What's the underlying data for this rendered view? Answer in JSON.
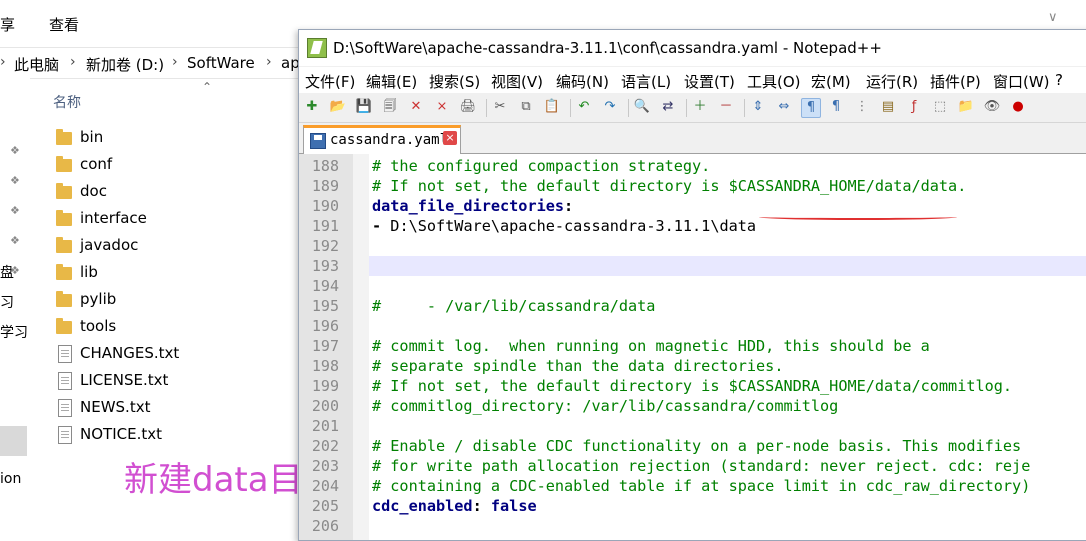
{
  "explorer": {
    "ribbon_tabs": [
      "享",
      "查看"
    ],
    "breadcrumb": [
      "此电脑",
      "新加卷 (D:)",
      "SoftWare",
      "ap"
    ],
    "column_header": "名称",
    "nav_fragments": [
      "盘",
      "习",
      "学习",
      "ion"
    ],
    "items": [
      {
        "name": "bin",
        "kind": "folder"
      },
      {
        "name": "conf",
        "kind": "folder"
      },
      {
        "name": "doc",
        "kind": "folder"
      },
      {
        "name": "interface",
        "kind": "folder"
      },
      {
        "name": "javadoc",
        "kind": "folder"
      },
      {
        "name": "lib",
        "kind": "folder"
      },
      {
        "name": "pylib",
        "kind": "folder"
      },
      {
        "name": "tools",
        "kind": "folder"
      },
      {
        "name": "CHANGES.txt",
        "kind": "file"
      },
      {
        "name": "LICENSE.txt",
        "kind": "file"
      },
      {
        "name": "NEWS.txt",
        "kind": "file"
      },
      {
        "name": "NOTICE.txt",
        "kind": "file"
      }
    ]
  },
  "overlay_note": "新建data目录",
  "npp": {
    "title": "D:\\SoftWare\\apache-cassandra-3.11.1\\conf\\cassandra.yaml - Notepad++",
    "menu": [
      "文件(F)",
      "编辑(E)",
      "搜索(S)",
      "视图(V)",
      "编码(N)",
      "语言(L)",
      "设置(T)",
      "工具(O)",
      "宏(M)",
      "运行(R)",
      "插件(P)",
      "窗口(W)",
      "?"
    ],
    "tab_label": "cassandra.yaml",
    "current_line": 193,
    "lines": [
      {
        "n": "188",
        "parts": [
          {
            "t": "# the configured compaction strategy.",
            "c": "comment"
          }
        ]
      },
      {
        "n": "189",
        "parts": [
          {
            "t": "# If not set, the default directory is $CASSANDRA_HOME/data/data.",
            "c": "comment"
          }
        ]
      },
      {
        "n": "190",
        "parts": [
          {
            "t": "data_file_directories",
            "c": "key"
          },
          {
            "t": ":",
            "c": "punct"
          }
        ]
      },
      {
        "n": "191",
        "parts": [
          {
            "t": "- ",
            "c": "punct"
          },
          {
            "t": "D:\\SoftWare\\apache-cassandra-3.11.1\\data",
            "c": "val"
          }
        ]
      },
      {
        "n": "192",
        "parts": []
      },
      {
        "n": "193",
        "parts": []
      },
      {
        "n": "194",
        "parts": []
      },
      {
        "n": "195",
        "parts": [
          {
            "t": "#     - /var/lib/cassandra/data",
            "c": "comment"
          }
        ]
      },
      {
        "n": "196",
        "parts": []
      },
      {
        "n": "197",
        "parts": [
          {
            "t": "# commit log.  when running on magnetic HDD, this should be a",
            "c": "comment"
          }
        ]
      },
      {
        "n": "198",
        "parts": [
          {
            "t": "# separate spindle than the data directories.",
            "c": "comment"
          }
        ]
      },
      {
        "n": "199",
        "parts": [
          {
            "t": "# If not set, the default directory is $CASSANDRA_HOME/data/commitlog.",
            "c": "comment"
          }
        ]
      },
      {
        "n": "200",
        "parts": [
          {
            "t": "# commitlog_directory: /var/lib/cassandra/commitlog",
            "c": "comment"
          }
        ]
      },
      {
        "n": "201",
        "parts": []
      },
      {
        "n": "202",
        "parts": [
          {
            "t": "# Enable / disable CDC functionality on a per-node basis. This modifies",
            "c": "comment"
          }
        ]
      },
      {
        "n": "203",
        "parts": [
          {
            "t": "# for write path allocation rejection (standard: never reject. cdc: reje",
            "c": "comment"
          }
        ]
      },
      {
        "n": "204",
        "parts": [
          {
            "t": "# containing a CDC-enabled table if at space limit in cdc_raw_directory)",
            "c": "comment"
          }
        ]
      },
      {
        "n": "205",
        "parts": [
          {
            "t": "cdc_enabled",
            "c": "key"
          },
          {
            "t": ": ",
            "c": "punct"
          },
          {
            "t": "false",
            "c": "bool"
          }
        ]
      },
      {
        "n": "206",
        "parts": []
      }
    ]
  },
  "toolbar_icons": [
    "new-file-icon",
    "open-file-icon",
    "save-icon",
    "save-all-icon",
    "close-icon",
    "close-all-icon",
    "print-icon",
    "cut-icon",
    "copy-icon",
    "paste-icon",
    "undo-icon",
    "redo-icon",
    "find-icon",
    "replace-icon",
    "zoom-in-icon",
    "zoom-out-icon",
    "sync-v-icon",
    "sync-h-icon",
    "word-wrap-icon",
    "show-all-chars-icon",
    "indent-guide-icon",
    "doc-map-icon",
    "function-list-icon",
    "lang-icon",
    "folder-workspace-icon",
    "monitor-icon",
    "record-macro-icon"
  ],
  "colors": {
    "comment": "#008000",
    "key": "#000080",
    "tab_accent": "#fa9d2b",
    "overlay": "#d14fd1"
  }
}
